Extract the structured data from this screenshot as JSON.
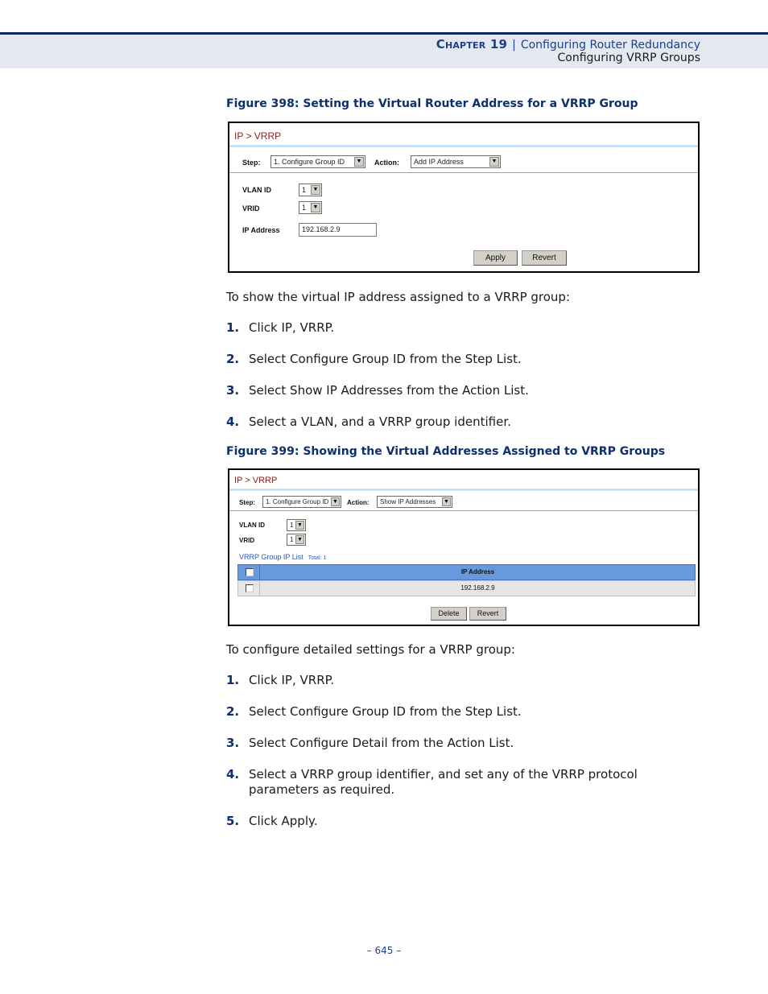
{
  "header": {
    "chapter_label": "Chapter 19",
    "separator": "|",
    "chapter_title": "Configuring Router Redundancy",
    "section_title": "Configuring VRRP Groups"
  },
  "figure398": {
    "caption": "Figure 398:  Setting the Virtual Router Address for a VRRP Group",
    "breadcrumb": "IP > VRRP",
    "step_label": "Step:",
    "step_value": "1. Configure Group ID",
    "action_label": "Action:",
    "action_value": "Add IP Address",
    "vlan_label": "VLAN ID",
    "vlan_value": "1",
    "vrid_label": "VRID",
    "vrid_value": "1",
    "ip_label": "IP Address",
    "ip_value": "192.168.2.9",
    "apply_label": "Apply",
    "revert_label": "Revert"
  },
  "section1": {
    "intro": "To show the virtual IP address assigned to a VRRP group:",
    "steps": [
      {
        "num": "1.",
        "text": "Click IP, VRRP."
      },
      {
        "num": "2.",
        "text": "Select Configure Group ID from the Step List."
      },
      {
        "num": "3.",
        "text": "Select Show IP Addresses from the Action List."
      },
      {
        "num": "4.",
        "text": "Select a VLAN, and a VRRP group identifier."
      }
    ]
  },
  "figure399": {
    "caption": "Figure 399:  Showing the Virtual Addresses Assigned to VRRP Groups",
    "breadcrumb": "IP > VRRP",
    "step_label": "Step:",
    "step_value": "1. Configure Group ID",
    "action_label": "Action:",
    "action_value": "Show IP Addresses",
    "vlan_label": "VLAN ID",
    "vlan_value": "1",
    "vrid_label": "VRID",
    "vrid_value": "1",
    "list_title": "VRRP Group IP List",
    "list_total": "Total: 1",
    "table": {
      "columns": [
        "IP Address"
      ],
      "rows": [
        [
          "192.168.2.9"
        ]
      ]
    },
    "delete_label": "Delete",
    "revert_label": "Revert"
  },
  "section2": {
    "intro": "To configure detailed settings for a VRRP group:",
    "steps": [
      {
        "num": "1.",
        "text": "Click IP, VRRP."
      },
      {
        "num": "2.",
        "text": "Select Configure Group ID from the Step List."
      },
      {
        "num": "3.",
        "text": "Select Configure Detail from the Action List."
      },
      {
        "num": "4.",
        "text": "Select a VRRP group identifier, and set any of the VRRP protocol parameters as required."
      },
      {
        "num": "5.",
        "text": "Click Apply."
      }
    ]
  },
  "footer": {
    "page_number": "–  645  –"
  },
  "icons": {
    "dropdown_arrow": "▼"
  }
}
